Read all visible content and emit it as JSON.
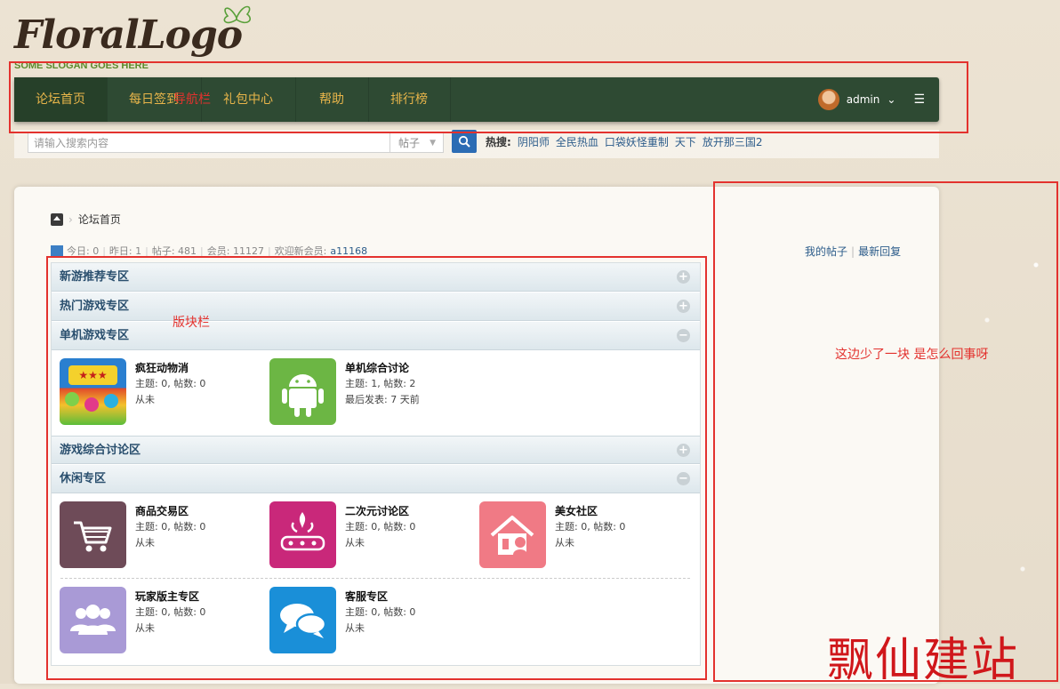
{
  "header": {
    "logo_text": "FloralLogo",
    "slogan": "SOME SLOGAN GOES HERE"
  },
  "nav": {
    "items": [
      {
        "label": "论坛首页",
        "active": true
      },
      {
        "label": "每日签到"
      },
      {
        "label": "礼包中心"
      },
      {
        "label": "帮助"
      },
      {
        "label": "排行榜"
      }
    ],
    "user": {
      "name": "admin",
      "caret": "⌄",
      "menu_icon": "list-icon"
    }
  },
  "annotations": {
    "nav_label": "导航栏",
    "board_label": "版块栏",
    "sidebar_note": "这边少了一块 是怎么回事呀",
    "watermark": "飘仙建站"
  },
  "search": {
    "placeholder": "请输入搜索内容",
    "type_selected": "帖子",
    "hot_label": "热搜:",
    "hot_terms": [
      "阴阳师",
      "全民热血",
      "口袋妖怪重制",
      "天下",
      "放开那三国2"
    ]
  },
  "breadcrumb": {
    "current": "论坛首页"
  },
  "stats": {
    "today": "今日: 0",
    "yesterday": "昨日: 1",
    "posts": "帖子: 481",
    "members": "会员: 11127",
    "welcome": "欢迎新会员:",
    "new_member": "a11168"
  },
  "sidebar": {
    "my_posts": "我的帖子",
    "latest_replies": "最新回复"
  },
  "categories": [
    {
      "title": "新游推荐专区",
      "toggle": "+"
    },
    {
      "title": "热门游戏专区",
      "toggle": "+"
    },
    {
      "title": "单机游戏专区",
      "toggle": "−",
      "forums": [
        {
          "name": "疯狂动物消",
          "stat": "主题: 0, 帖数: 0",
          "last": "从未",
          "icon": "game-icon",
          "color": "#2a7fd0"
        },
        {
          "name": "单机综合讨论",
          "stat": "主题: 1, 帖数: 2",
          "last": "最后发表: 7 天前",
          "icon": "android-icon",
          "color": "#6cb644"
        }
      ]
    },
    {
      "title": "游戏综合讨论区",
      "toggle": "+"
    },
    {
      "title": "休闲专区",
      "toggle": "−",
      "forums": [
        {
          "name": "商品交易区",
          "stat": "主题: 0, 帖数: 0",
          "last": "从未",
          "icon": "cart-icon",
          "color": "#6e4b58"
        },
        {
          "name": "二次元讨论区",
          "stat": "主题: 0, 帖数: 0",
          "last": "从未",
          "icon": "kawayi-icon",
          "color": "#c9287a"
        },
        {
          "name": "美女社区",
          "stat": "主题: 0, 帖数: 0",
          "last": "从未",
          "icon": "girl-house-icon",
          "color": "#f07a85"
        },
        {
          "name": "玩家版主专区",
          "stat": "主题: 0, 帖数: 0",
          "last": "从未",
          "icon": "group-icon",
          "color": "#a99ad6"
        },
        {
          "name": "客服专区",
          "stat": "主题: 0, 帖数: 0",
          "last": "从未",
          "icon": "chat-icon",
          "color": "#1a8fd8"
        }
      ]
    }
  ]
}
